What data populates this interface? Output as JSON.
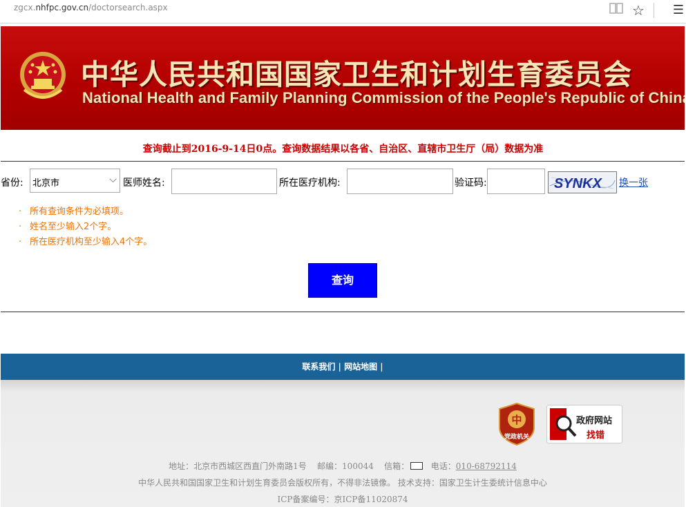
{
  "browser": {
    "url_prefix": "zgcx.",
    "url_domain": "nhfpc.gov.cn",
    "url_path": "/doctorsearch.aspx"
  },
  "banner": {
    "title_cn": "中华人民共和国国家卫生和计划生育委员会",
    "title_en": "National Health and Family Planning Commission of the People's Republic of China"
  },
  "notice": "查询截止到2016-9-14日0点。查询数据结果以各省、自治区、直辖市卫生厅（局）数据为准",
  "form": {
    "province_label": "省份:",
    "province_value": "北京市",
    "doctor_name_label": "医师姓名:",
    "doctor_name_value": "",
    "institution_label": "所在医疗机构:",
    "institution_value": "",
    "captcha_label": "验证码:",
    "captcha_value": "",
    "captcha_text": "SYNKX",
    "refresh_label": "换一张",
    "search_button": "查询"
  },
  "tips": [
    "所有查询条件为必填项。",
    "姓名至少输入2个字。",
    "所在医疗机构至少输入4个字。"
  ],
  "footer": {
    "nav": [
      "联系我们",
      "网站地图"
    ],
    "badge_party": "党政机关",
    "badge_gov_line1": "政府网站",
    "badge_gov_line2": "找错",
    "address": "地址：北京市西城区西直门外南路1号",
    "postcode": "邮编：100044",
    "mailbox_label": "信箱：",
    "phone_label": "电话：",
    "phone": "010-68792114",
    "copyright": "中华人民共和国国家卫生和计划生育委员会版权所有，不得非法镜像。 技术支持：国家卫生计生委统计信息中心",
    "icp": "ICP备案编号：京ICP备11020874"
  },
  "colors": {
    "banner_red": "#b30000",
    "notice_red": "#cc0000",
    "tip_orange": "#e8730a",
    "button_blue": "#0000ff",
    "footer_nav_blue": "#1a6399"
  }
}
